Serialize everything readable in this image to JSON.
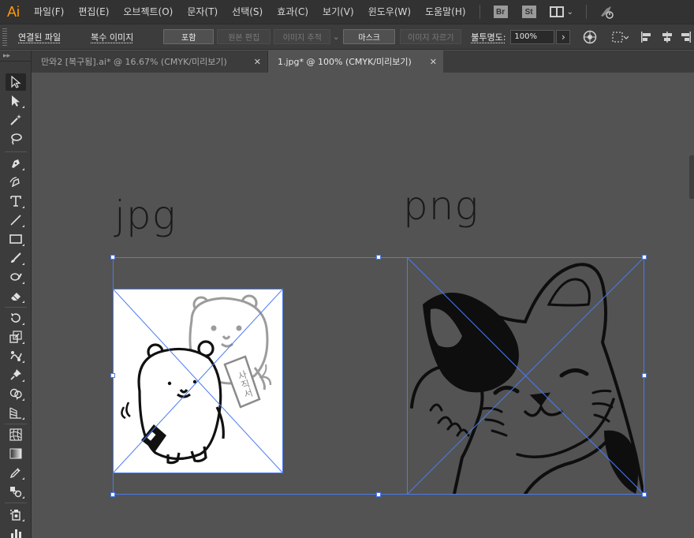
{
  "app": {
    "logo": "Ai"
  },
  "menu": {
    "items": [
      "파일(F)",
      "편집(E)",
      "오브젝트(O)",
      "문자(T)",
      "선택(S)",
      "효과(C)",
      "보기(V)",
      "윈도우(W)",
      "도움말(H)"
    ],
    "bridge_label": "Br",
    "stock_label": "St"
  },
  "control": {
    "linked_file": "연결된 파일",
    "image_mode": "복수 이미지",
    "embed": "포함",
    "edit_original": "원본 편집",
    "image_trace": "이미지 추적",
    "mask": "마스크",
    "crop_image": "이미지 자르기",
    "opacity_label": "불투명도:",
    "opacity_value": "100%",
    "arrow": "›"
  },
  "tabs": [
    {
      "label": "만와2 [복구됨].ai* @ 16.67% (CMYK/미리보기)",
      "active": false
    },
    {
      "label": "1.jpg* @ 100% (CMYK/미리보기)",
      "active": true
    }
  ],
  "toolbar": {
    "collapse_glyph": "▸▸"
  },
  "canvas": {
    "label_left": "jpg",
    "label_right": "png",
    "jpg_doc_text": "사직서"
  },
  "colors": {
    "selection": "#4b7bef",
    "accent": "#ff9a00"
  }
}
